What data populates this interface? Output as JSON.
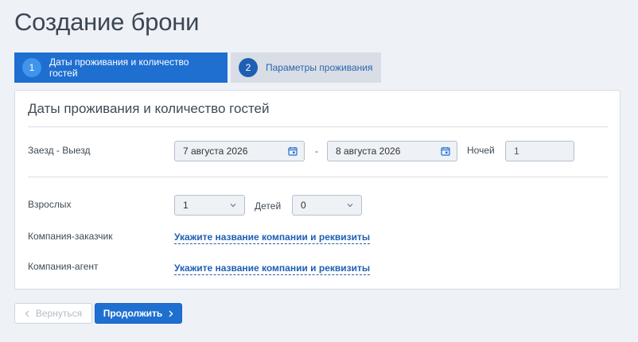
{
  "page": {
    "title": "Создание брони"
  },
  "steps": [
    {
      "number": "1",
      "label": "Даты проживания и количество гостей",
      "state": "active"
    },
    {
      "number": "2",
      "label": "Параметры проживания",
      "state": "inactive"
    }
  ],
  "card": {
    "title": "Даты проживания и количество гостей",
    "dates": {
      "label": "Заезд - Выезд",
      "checkin": "7 августа 2026",
      "separator": "-",
      "checkout": "8 августа 2026",
      "nights_label": "Ночей",
      "nights_value": "1"
    },
    "guests": {
      "adults_label": "Взрослых",
      "adults_value": "1",
      "children_label": "Детей",
      "children_value": "0"
    },
    "customer": {
      "label": "Компания-заказчик",
      "link": "Укажите название компании и реквизиты"
    },
    "agent": {
      "label": "Компания-агент",
      "link": "Укажите название компании и реквизиты"
    }
  },
  "buttons": {
    "back": "Вернуться",
    "next": "Продолжить"
  },
  "colors": {
    "accent": "#1e6fd0",
    "background": "#eef1f5",
    "link": "#1f5fb2"
  },
  "icons": {
    "back": "chevron-left-icon",
    "next": "chevron-right-icon",
    "date": "calendar-icon",
    "select": "chevron-down-icon"
  }
}
